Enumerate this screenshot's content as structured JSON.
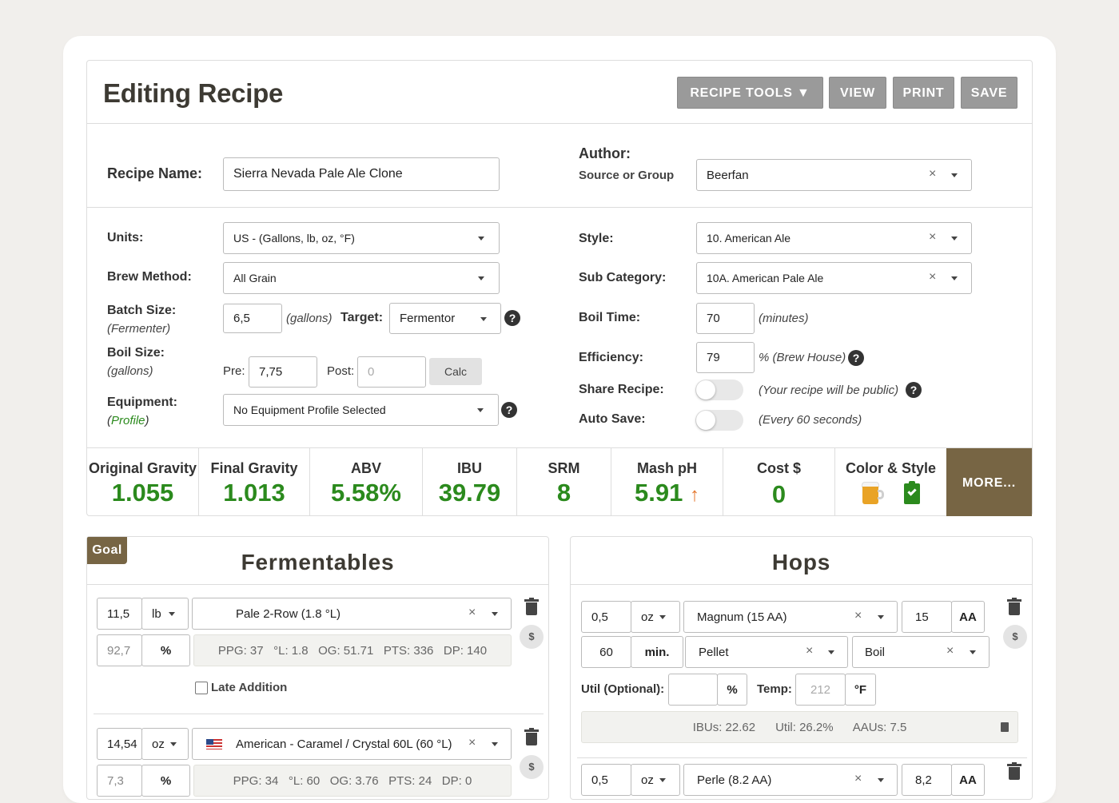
{
  "header": {
    "title": "Editing Recipe",
    "buttons": {
      "recipe_tools": "RECIPE TOOLS ▼",
      "view": "VIEW",
      "print": "PRINT",
      "save": "SAVE"
    }
  },
  "form": {
    "recipe_name_label": "Recipe Name:",
    "recipe_name": "Sierra Nevada Pale Ale Clone",
    "author_label": "Author:",
    "author_sub": "Source or Group",
    "author": "Beerfan",
    "units_label": "Units:",
    "units": "US - (Gallons, lb, oz, °F)",
    "brew_method_label": "Brew Method:",
    "brew_method": "All Grain",
    "batch_size_label": "Batch Size:",
    "batch_size_sub": "(Fermenter)",
    "batch_size": "6,5",
    "batch_unit": "(gallons)",
    "target_label": "Target:",
    "target": "Fermentor",
    "boil_size_label": "Boil Size:",
    "boil_size_sub": "(gallons)",
    "pre_label": "Pre:",
    "pre": "7,75",
    "post_label": "Post:",
    "post_placeholder": "0",
    "calc": "Calc",
    "equipment_label": "Equipment:",
    "equipment_open": "(",
    "equipment_link": "Profile",
    "equipment_close": ")",
    "equipment": "No Equipment Profile Selected",
    "style_label": "Style:",
    "style": "10. American Ale",
    "subcat_label": "Sub Category:",
    "subcat": "10A. American Pale Ale",
    "boil_time_label": "Boil Time:",
    "boil_time": "70",
    "boil_time_unit": "(minutes)",
    "efficiency_label": "Efficiency:",
    "efficiency": "79",
    "efficiency_unit": "% (Brew House)",
    "share_label": "Share Recipe:",
    "share_note": "(Your recipe will be public)",
    "autosave_label": "Auto Save:",
    "autosave_note": "(Every 60 seconds)",
    "clear": "×"
  },
  "stats": [
    {
      "label": "Original Gravity",
      "value": "1.055"
    },
    {
      "label": "Final Gravity",
      "value": "1.013"
    },
    {
      "label": "ABV",
      "value": "5.58%"
    },
    {
      "label": "IBU",
      "value": "39.79"
    },
    {
      "label": "SRM",
      "value": "8"
    },
    {
      "label": "Mash pH",
      "value": "5.91",
      "arrow": "↑"
    },
    {
      "label": "Cost $",
      "value": "0"
    },
    {
      "label": "Color & Style",
      "value": ""
    }
  ],
  "more": "MORE...",
  "fermentables": {
    "title": "Fermentables",
    "goal": "Goal",
    "items": [
      {
        "amount": "11,5",
        "unit": "lb",
        "name": "Pale 2-Row (1.8 °L)",
        "percent": "92,7",
        "pct_sign": "%",
        "info": "PPG: 37   °L: 1.8   OG: 51.71   PTS: 336   DP: 140",
        "late": "Late Addition"
      },
      {
        "amount": "14,54",
        "unit": "oz",
        "name": "American - Caramel / Crystal 60L (60 °L)",
        "percent": "7,3",
        "pct_sign": "%",
        "info": "PPG: 34   °L: 60   OG: 3.76   PTS: 24   DP: 0"
      }
    ]
  },
  "hops": {
    "title": "Hops",
    "items": [
      {
        "amount": "0,5",
        "unit": "oz",
        "name": "Magnum (15 AA)",
        "aa": "15",
        "aa_label": "AA",
        "time": "60",
        "time_unit": "min.",
        "form": "Pellet",
        "use": "Boil",
        "util_label": "Util (Optional):",
        "util_pct": "%",
        "temp_label": "Temp:",
        "temp_placeholder": "212",
        "temp_unit": "°F",
        "info": "IBUs: 22.62      Util: 26.2%      AAUs: 7.5"
      },
      {
        "amount": "0,5",
        "unit": "oz",
        "name": "Perle (8.2 AA)",
        "aa": "8,2",
        "aa_label": "AA"
      }
    ]
  },
  "icons": {
    "dollar": "$",
    "help": "?"
  }
}
